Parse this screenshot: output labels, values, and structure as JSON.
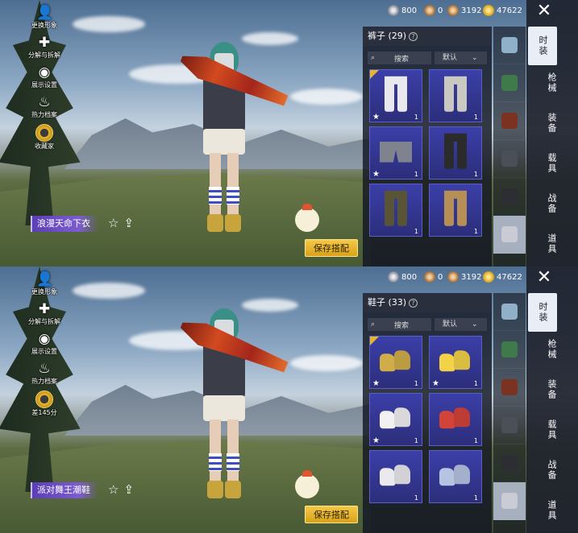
{
  "screens": [
    {
      "left_menu": {
        "items": [
          {
            "label": "更换形象",
            "icon": "avatar-icon"
          },
          {
            "label": "分解与拆解",
            "icon": "puzzle-icon"
          },
          {
            "label": "展示设置",
            "icon": "eye-icon"
          },
          {
            "label": "热力档案",
            "icon": "flame-icon"
          },
          {
            "label": "收藏家",
            "icon": "collector-badge-icon"
          }
        ]
      },
      "currencies": [
        {
          "icon": "silver-coin-icon",
          "value": "800"
        },
        {
          "icon": "bronze-coin-icon",
          "value": "0"
        },
        {
          "icon": "uc-coin-icon",
          "value": "3192"
        },
        {
          "icon": "gold-coin-icon",
          "value": "47622"
        }
      ],
      "panel": {
        "title": "裤子 (29)",
        "search_label": "搜索",
        "sort_label": "默认"
      },
      "items": [
        {
          "count": "1",
          "favorite": true,
          "corner": true,
          "kind": "pants",
          "color": "#e8e8ee"
        },
        {
          "count": "1",
          "favorite": false,
          "corner": false,
          "kind": "pants",
          "color": "#c9c9c2"
        },
        {
          "count": "1",
          "favorite": true,
          "corner": false,
          "kind": "shorts",
          "color": "#7e838e"
        },
        {
          "count": "1",
          "favorite": false,
          "corner": false,
          "kind": "pants",
          "color": "#2b2b2b"
        },
        {
          "count": "1",
          "favorite": false,
          "corner": false,
          "kind": "pants",
          "color": "#5a5436"
        },
        {
          "count": "1",
          "favorite": false,
          "corner": false,
          "kind": "pants",
          "color": "#b58f56"
        }
      ],
      "name_banner": "浪漫天命下衣",
      "save_button": "保存搭配",
      "nav": {
        "close": "✕",
        "items": [
          "时装",
          "枪械",
          "装备",
          "载具",
          "战备",
          "道具"
        ]
      },
      "category_icons": [
        "emote-icon",
        "parachute-icon",
        "hat-icon",
        "helmet-icon",
        "gloves-icon",
        "pants-icon"
      ]
    },
    {
      "left_menu": {
        "items": [
          {
            "label": "更换形象",
            "icon": "avatar-icon"
          },
          {
            "label": "分解与拆解",
            "icon": "puzzle-icon"
          },
          {
            "label": "展示设置",
            "icon": "eye-icon"
          },
          {
            "label": "热力档案",
            "icon": "flame-icon"
          },
          {
            "label": "差145分",
            "icon": "collector-badge-icon"
          }
        ]
      },
      "currencies": [
        {
          "icon": "silver-coin-icon",
          "value": "800"
        },
        {
          "icon": "bronze-coin-icon",
          "value": "0"
        },
        {
          "icon": "uc-coin-icon",
          "value": "3192"
        },
        {
          "icon": "gold-coin-icon",
          "value": "47622"
        }
      ],
      "panel": {
        "title": "鞋子 (33)",
        "search_label": "搜索",
        "sort_label": "默认"
      },
      "items": [
        {
          "count": "1",
          "favorite": true,
          "corner": true,
          "kind": "shoes",
          "color": "#d1ad4a"
        },
        {
          "count": "1",
          "favorite": true,
          "corner": false,
          "kind": "shoes",
          "color": "#f2d247"
        },
        {
          "count": "1",
          "favorite": true,
          "corner": false,
          "kind": "shoes",
          "color": "#f2f0f2"
        },
        {
          "count": "1",
          "favorite": false,
          "corner": false,
          "kind": "shoes",
          "color": "#d2433a"
        },
        {
          "count": "1",
          "favorite": false,
          "corner": false,
          "kind": "shoes",
          "color": "#e9e9ee"
        },
        {
          "count": "1",
          "favorite": false,
          "corner": false,
          "kind": "shoes",
          "color": "#b6c4e2"
        }
      ],
      "name_banner": "派对舞王潮鞋",
      "save_button": "保存搭配",
      "nav": {
        "close": "✕",
        "items": [
          "时装",
          "枪械",
          "装备",
          "载具",
          "战备",
          "道具"
        ]
      },
      "category_icons": [
        "emote-icon",
        "parachute-icon",
        "hat-icon",
        "helmet-icon",
        "gloves-icon",
        "shoes-icon"
      ]
    }
  ]
}
